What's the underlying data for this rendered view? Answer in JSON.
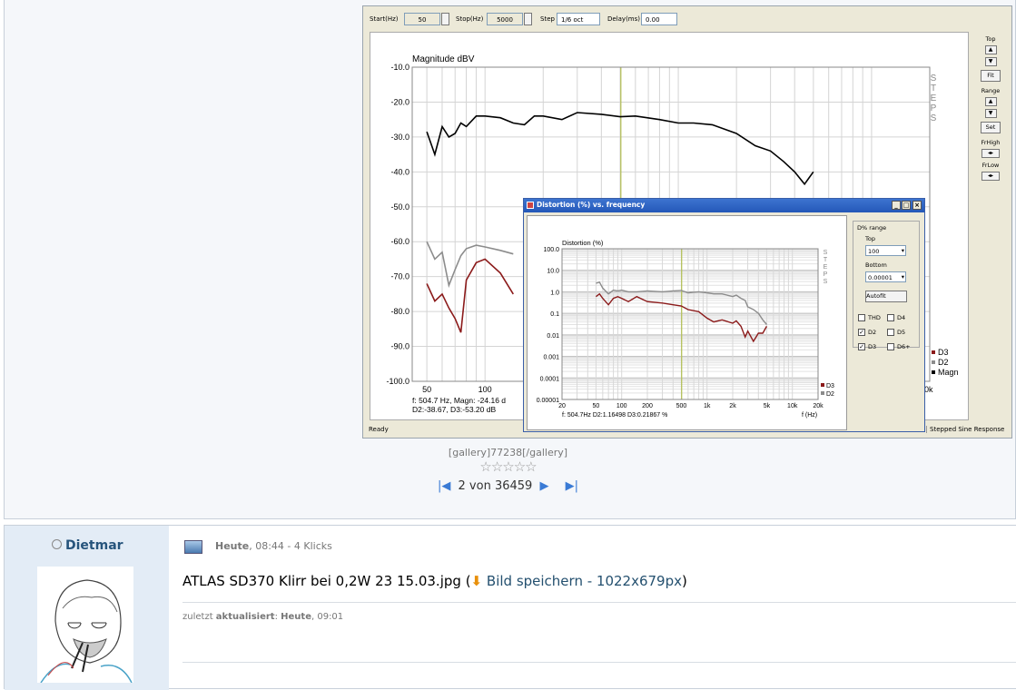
{
  "toolbar": {
    "start_label": "Start(Hz)",
    "start_value": "50",
    "stop_label": "Stop(Hz)",
    "stop_value": "5000",
    "step_label": "Step",
    "step_value": "1/6 oct",
    "delay_label": "Delay(ms)",
    "delay_value": "0.00"
  },
  "right_panel": {
    "top": "Top",
    "fit": "Fit",
    "range": "Range",
    "set": "Set",
    "frhigh": "FrHigh",
    "frlow": "FrLow"
  },
  "status": {
    "left": "Ready",
    "right": "Stepped Sine Response"
  },
  "main_plot": {
    "ylabel": "Magnitude dBV",
    "steps": "STEPS",
    "yticks": [
      "-10.0",
      "-20.0",
      "-30.0",
      "-40.0",
      "-50.0",
      "-60.0",
      "-70.0",
      "-80.0",
      "-90.0",
      "-100.0"
    ],
    "xticks": [
      "50",
      "100"
    ],
    "xtick_partial": "0k",
    "readout1": "f:  504.7 Hz, Magn: -24.16 d",
    "readout2": "D2:-38.67, D3:-53.20 dB",
    "legend": [
      "D3",
      "D2",
      "Magn"
    ]
  },
  "dialog": {
    "title": "Distortion (%) vs. frequency",
    "ylabel": "Distortion (%)",
    "steps": "STEPS",
    "yticks": [
      "100.0",
      "10.0",
      "1.0",
      "0.1",
      "0.01",
      "0.001",
      "0.0001",
      "0.00001"
    ],
    "xticks": [
      "20",
      "50",
      "100",
      "200",
      "500",
      "1k",
      "2k",
      "5k",
      "10k",
      "20k"
    ],
    "xunit": "f (Hz)",
    "readout": "f: 504.7Hz    D2:1.16498  D3:0.21867 %",
    "legend": [
      "D3",
      "D2"
    ],
    "range_group": "D% range",
    "top_label": "Top",
    "top_value": "100",
    "bottom_label": "Bottom",
    "bottom_value": "0.00001",
    "autofit": "Autofit",
    "checks": [
      {
        "label": "THD",
        "checked": false
      },
      {
        "label": "D4",
        "checked": false
      },
      {
        "label": "D2",
        "checked": true
      },
      {
        "label": "D5",
        "checked": false
      },
      {
        "label": "D3",
        "checked": true
      },
      {
        "label": "D6+",
        "checked": false
      }
    ]
  },
  "chart_data": [
    {
      "type": "line",
      "title": "",
      "ylabel": "Magnitude dBV",
      "xlabel": "",
      "ylim": [
        -100,
        -10
      ],
      "xscale": "log",
      "series": [
        {
          "name": "Magn",
          "color": "#000000",
          "x": [
            50,
            55,
            60,
            65,
            70,
            75,
            80,
            90,
            100,
            120,
            140,
            160,
            180,
            200,
            250,
            300,
            400,
            500,
            600,
            800,
            1000,
            1200,
            1500,
            2000,
            2500,
            3000,
            3500,
            4000,
            4500,
            5000
          ],
          "y": [
            -28.5,
            -35,
            -27,
            -30,
            -29,
            -26,
            -27,
            -24,
            -24,
            -24.5,
            -26,
            -26.5,
            -24,
            -24,
            -25,
            -23,
            -23.5,
            -24.2,
            -24,
            -25,
            -26,
            -26,
            -26.5,
            -29,
            -32.5,
            -34,
            -37,
            -40,
            -43.5,
            -40
          ]
        },
        {
          "name": "D2",
          "color": "#8c8c8c",
          "x": [
            50,
            55,
            60,
            65,
            70,
            75,
            80,
            90,
            100,
            120,
            140
          ],
          "y": [
            -60,
            -65,
            -63,
            -72.5,
            -68,
            -64,
            -62,
            -61,
            -61.5,
            -62.5,
            -63.5
          ]
        },
        {
          "name": "D3",
          "color": "#8b1a1a",
          "x": [
            50,
            55,
            60,
            65,
            70,
            75,
            80,
            90,
            100,
            120,
            140
          ],
          "y": [
            -72,
            -77,
            -75,
            -79,
            -82,
            -86,
            -71,
            -66,
            -65,
            -69,
            -75
          ]
        }
      ]
    },
    {
      "type": "line",
      "title": "",
      "ylabel": "Distortion (%)",
      "xlabel": "f (Hz)",
      "yscale": "log",
      "xscale": "log",
      "ylim": [
        1e-05,
        100
      ],
      "series": [
        {
          "name": "D2",
          "color": "#8c8c8c",
          "x": [
            50,
            55,
            60,
            70,
            80,
            90,
            100,
            120,
            150,
            200,
            300,
            400,
            500,
            600,
            800,
            1000,
            1200,
            1500,
            2000,
            2200,
            2500,
            2800,
            3000,
            3500,
            4000,
            4500,
            5000
          ],
          "y": [
            2.5,
            2.8,
            1.5,
            0.8,
            1.2,
            1.1,
            1.2,
            1.0,
            1.0,
            1.1,
            1.0,
            1.1,
            1.16,
            0.9,
            1.0,
            0.9,
            0.8,
            0.8,
            0.6,
            0.7,
            0.5,
            0.4,
            0.2,
            0.15,
            0.1,
            0.05,
            0.03
          ]
        },
        {
          "name": "D3",
          "color": "#8b1a1a",
          "x": [
            50,
            55,
            60,
            70,
            80,
            90,
            100,
            120,
            150,
            200,
            300,
            400,
            500,
            600,
            800,
            1000,
            1200,
            1500,
            2000,
            2200,
            2500,
            2800,
            3000,
            3500,
            4000,
            4500,
            5000
          ],
          "y": [
            0.6,
            0.8,
            0.5,
            0.25,
            0.5,
            0.6,
            0.5,
            0.35,
            0.6,
            0.35,
            0.3,
            0.25,
            0.22,
            0.15,
            0.12,
            0.06,
            0.04,
            0.05,
            0.035,
            0.045,
            0.025,
            0.008,
            0.015,
            0.005,
            0.012,
            0.012,
            0.025
          ]
        }
      ]
    }
  ],
  "gallery": {
    "tag": "[gallery]77238[/gallery]",
    "pagination": "2 von 36459"
  },
  "post": {
    "username": "Dietmar",
    "date_bold": "Heute",
    "date_rest": ", 08:44 - 4 Klicks",
    "filename": "ATLAS SD370 Klirr bei 0,2W 23 15.03.jpg",
    "save_link": "Bild speichern - 1022x679px",
    "updated_prefix": "zuletzt ",
    "updated_bold": "aktualisiert",
    "updated_colon": ": ",
    "updated_date_bold": "Heute",
    "updated_time": ", 09:01"
  }
}
